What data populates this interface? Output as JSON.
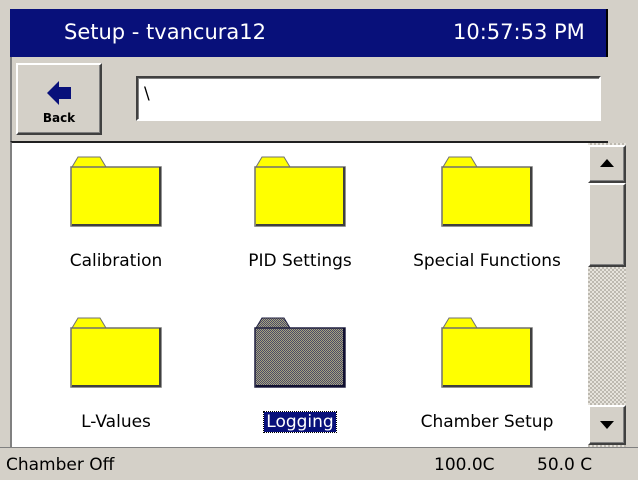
{
  "header": {
    "title": "Setup - tvancura12",
    "clock": "10:57:53 PM"
  },
  "toolbar": {
    "back_label": "Back",
    "path_value": "\\"
  },
  "folders": [
    {
      "label": "Calibration",
      "selected": false
    },
    {
      "label": "PID Settings",
      "selected": false
    },
    {
      "label": "Special Functions",
      "selected": false
    },
    {
      "label": "L-Values",
      "selected": false
    },
    {
      "label": "Logging",
      "selected": true
    },
    {
      "label": "Chamber Setup",
      "selected": false
    }
  ],
  "status": {
    "chamber_state": "Chamber Off",
    "temp_actual": "100.0C",
    "temp_setpoint": "50.0 C"
  },
  "colors": {
    "titlebar": "#08107a",
    "folder_fill": "#ffff00",
    "folder_selected_fill": "#8a8a6e",
    "selection_highlight": "#08107a"
  }
}
